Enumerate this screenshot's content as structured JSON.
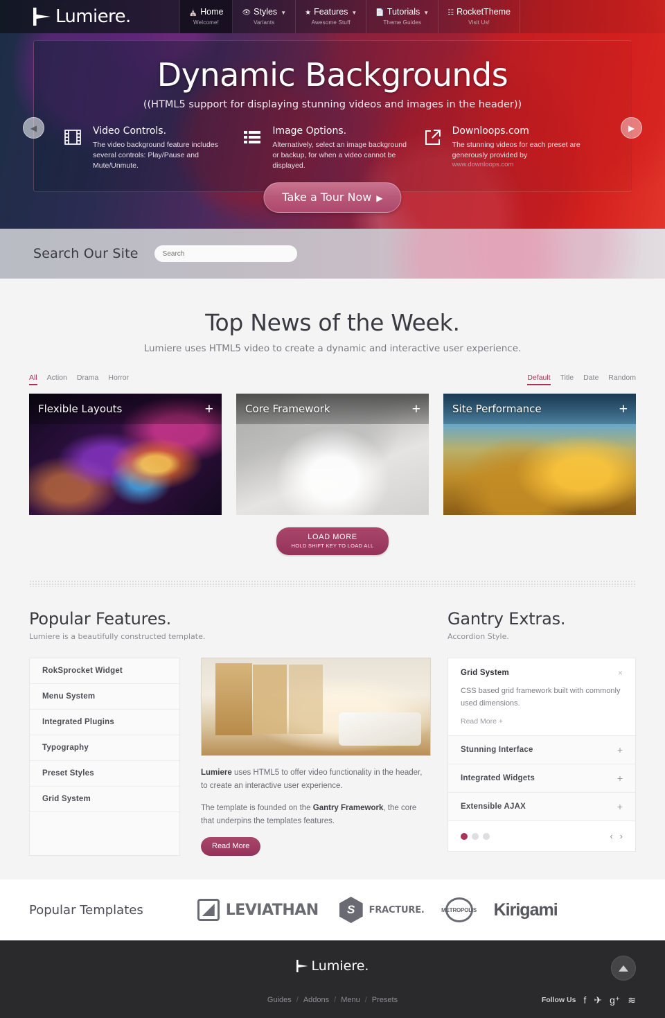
{
  "header": {
    "logo_text": "Lumiere.",
    "logo_icon": "play-triangle-icon",
    "nav": [
      {
        "label": "Home",
        "sub": "Welcome!",
        "icon": "home-icon",
        "caret": false,
        "active": true
      },
      {
        "label": "Styles",
        "sub": "Variants",
        "icon": "eye-icon",
        "caret": true,
        "active": false
      },
      {
        "label": "Features",
        "sub": "Awesome Stuff",
        "icon": "star-icon",
        "caret": true,
        "active": false
      },
      {
        "label": "Tutorials",
        "sub": "Theme Guides",
        "icon": "file-icon",
        "caret": true,
        "active": false
      },
      {
        "label": "RocketTheme",
        "sub": "Visit Us!",
        "icon": "window-icon",
        "caret": false,
        "active": false
      }
    ]
  },
  "hero": {
    "title": "Dynamic Backgrounds",
    "subtitle": "((HTML5 support for displaying stunning videos and images in the header))",
    "columns": [
      {
        "icon": "film-icon",
        "title": "Video Controls.",
        "text": "The video background feature includes several controls: Play/Pause and Mute/Unmute.",
        "link": ""
      },
      {
        "icon": "list-icon",
        "title": "Image Options.",
        "text": "Alternatively, select an image background or backup, for when a video cannot be displayed.",
        "link": ""
      },
      {
        "icon": "external-link-icon",
        "title": "Downloops.com",
        "text": "The stunning videos for each preset are generously provided by",
        "link": "www.downloops.com"
      }
    ],
    "tour_button": "Take a Tour Now",
    "prev_arrow": "◀",
    "next_arrow": "▶"
  },
  "search": {
    "label": "Search Our Site",
    "placeholder": "Search",
    "value": ""
  },
  "news": {
    "title": "Top News of the Week.",
    "lead": "Lumiere uses HTML5 video to create a dynamic and interactive user experience.",
    "filters_left": [
      {
        "label": "All",
        "active": true
      },
      {
        "label": "Action",
        "active": false
      },
      {
        "label": "Drama",
        "active": false
      },
      {
        "label": "Horror",
        "active": false
      }
    ],
    "filters_right": [
      {
        "label": "Default",
        "active": true
      },
      {
        "label": "Title",
        "active": false
      },
      {
        "label": "Date",
        "active": false
      },
      {
        "label": "Random",
        "active": false
      }
    ],
    "cards": [
      {
        "title": "Flexible Layouts",
        "plus": "+",
        "art": "art1"
      },
      {
        "title": "Core Framework",
        "plus": "+",
        "art": "art2"
      },
      {
        "title": "Site Performance",
        "plus": "+",
        "art": "art3"
      }
    ],
    "load_more": {
      "line1": "LOAD MORE",
      "line2": "HOLD SHIFT KEY TO LOAD ALL"
    }
  },
  "features": {
    "title": "Popular Features.",
    "subtitle": "Lumiere is a beautifully constructed template.",
    "items": [
      "RokSprocket Widget",
      "Menu System",
      "Integrated Plugins",
      "Typography",
      "Preset Styles",
      "Grid System"
    ],
    "body_p1_bold": "Lumiere",
    "body_p1_rest": " uses HTML5 to offer video functionality in the header, to create an interactive user experience.",
    "body_p2_pre": "The template is founded on the ",
    "body_p2_bold": "Gantry Framework",
    "body_p2_post": ", the core that underpins the templates features.",
    "read_more": "Read More"
  },
  "extras": {
    "title": "Gantry Extras.",
    "subtitle": "Accordion Style.",
    "open_panel": {
      "title": "Grid System",
      "close_icon": "×",
      "body": "CSS based grid framework built with commonly used dimensions.",
      "read_more": "Read More +"
    },
    "items": [
      {
        "title": "Stunning Interface",
        "plus": "+"
      },
      {
        "title": "Integrated Widgets",
        "plus": "+"
      },
      {
        "title": "Extensible AJAX",
        "plus": "+"
      }
    ],
    "pager": {
      "dots": [
        true,
        false,
        false
      ],
      "prev": "‹",
      "next": "›"
    }
  },
  "templates": {
    "label": "Popular Templates",
    "logos": [
      {
        "name": "LEVIATHAN",
        "glyph": "square-glyph-icon"
      },
      {
        "name": "FRACTURE.",
        "glyph": "hexagon-glyph-icon"
      },
      {
        "name": "METROPOLIS",
        "glyph": "ring-glyph-icon"
      },
      {
        "name": "Kirigami",
        "glyph": ""
      }
    ]
  },
  "footer": {
    "logo_text": "Lumiere.",
    "links": [
      "Guides",
      "Addons",
      "Menu",
      "Presets"
    ],
    "separator": "/",
    "follow_label": "Follow Us",
    "social": [
      {
        "name": "facebook-icon",
        "glyph": "f"
      },
      {
        "name": "twitter-icon",
        "glyph": "✈"
      },
      {
        "name": "google-plus-icon",
        "glyph": "g⁺"
      },
      {
        "name": "rss-icon",
        "glyph": "≋"
      }
    ],
    "to_top_icon": "arrow-up-icon"
  },
  "colors": {
    "accent": "#a63457",
    "accent_button": "#95325a",
    "dark_footer": "#2a2a2c",
    "page_bg": "#f4f4f4"
  }
}
